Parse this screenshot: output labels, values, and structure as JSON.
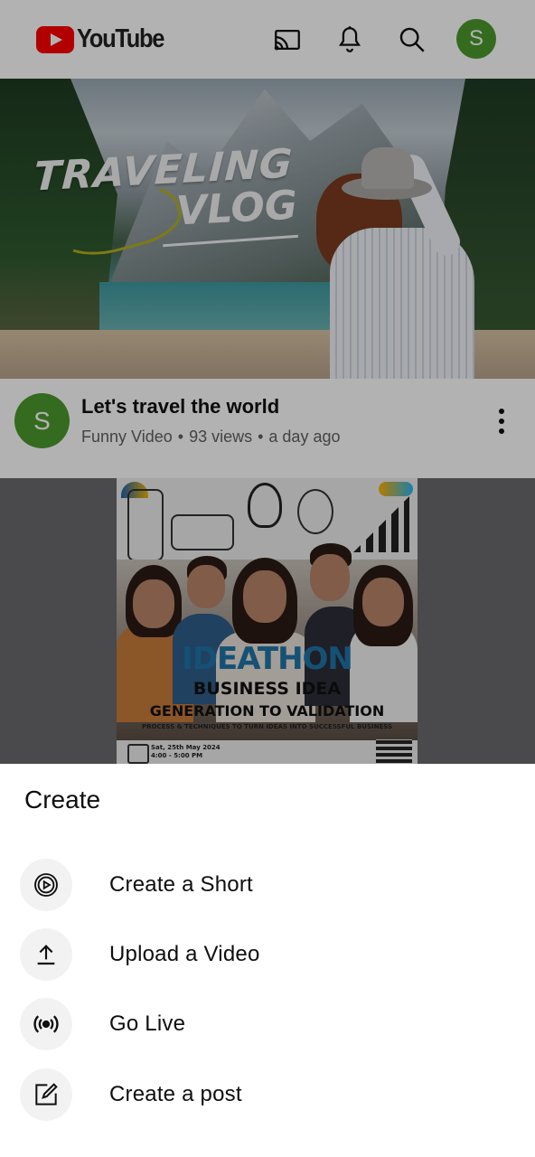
{
  "colors": {
    "brand_red": "#ff0000",
    "avatar_green": "#4b9a2d",
    "sheet_bg": "#ffffff",
    "icon_bg": "#f2f2f2"
  },
  "header": {
    "logo_text": "YouTube",
    "icons": [
      "cast-icon",
      "bell-icon",
      "search-icon"
    ],
    "avatar_letter": "S"
  },
  "video1": {
    "thumbnail_text_1": "TRAVELING",
    "thumbnail_text_2": "VLOG",
    "title": "Let's travel the world",
    "channel": "Funny Video",
    "views": "93 views",
    "age": "a day ago",
    "avatar_letter": "S"
  },
  "video2": {
    "poster_heading": "IDEATHON",
    "poster_line1": "BUSINESS IDEA",
    "poster_line2": "GENERATION TO VALIDATION",
    "poster_line3": "PROCESS & TECHNIQUES TO TURN IDEAS INTO SUCCESSFUL BUSINESS",
    "poster_date": "Sat, 25th May 2024",
    "poster_time": "4:00 - 5:00 PM"
  },
  "sheet": {
    "title": "Create",
    "options": [
      {
        "label": "Create a Short",
        "icon": "shorts-play-icon"
      },
      {
        "label": "Upload a Video",
        "icon": "upload-icon"
      },
      {
        "label": "Go Live",
        "icon": "live-broadcast-icon"
      },
      {
        "label": "Create a post",
        "icon": "edit-post-icon"
      }
    ]
  }
}
